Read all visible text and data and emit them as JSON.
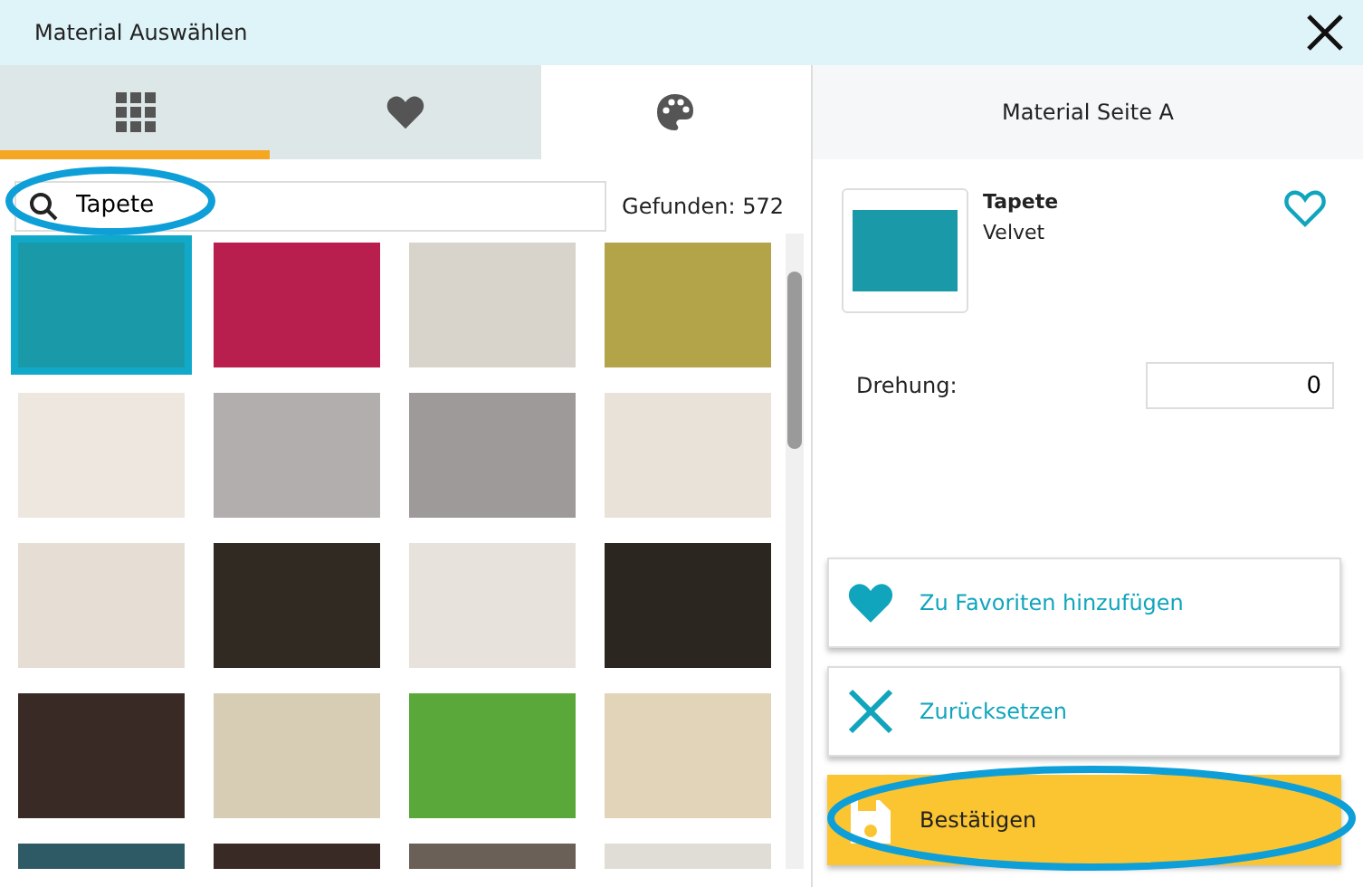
{
  "window": {
    "title": "Material Auswählen"
  },
  "tabs": [
    {
      "kind": "grid",
      "selected": false,
      "highlighted": true
    },
    {
      "kind": "heart",
      "selected": false,
      "highlighted": false
    },
    {
      "kind": "palette",
      "selected": true,
      "highlighted": false
    }
  ],
  "search": {
    "value": "Tapete",
    "result_count": "Gefunden: 572"
  },
  "swatches": [
    {
      "color": "#1a9aa8",
      "selected": true
    },
    {
      "color": "#b81e4e",
      "selected": false
    },
    {
      "color": "#d8d4cc",
      "selected": false
    },
    {
      "color": "#b3a44a",
      "selected": false
    },
    {
      "color": "#ede7e0",
      "selected": false
    },
    {
      "color": "#b3aeae",
      "selected": false
    },
    {
      "color": "#9e9a9a",
      "selected": false
    },
    {
      "color": "#e9e2d8",
      "selected": false
    },
    {
      "color": "#e6ded4",
      "selected": false
    },
    {
      "color": "#312a22",
      "selected": false
    },
    {
      "color": "#e8e2dd",
      "selected": false
    },
    {
      "color": "#2c2620",
      "selected": false
    },
    {
      "color": "#3a2a26",
      "selected": false
    },
    {
      "color": "#d7cdb5",
      "selected": false
    },
    {
      "color": "#5aa83a",
      "selected": false
    },
    {
      "color": "#e1d4b8",
      "selected": false
    },
    {
      "color": "#2e5a66",
      "selected": false
    },
    {
      "color": "#3a2a26",
      "selected": false
    },
    {
      "color": "#6a6058",
      "selected": false
    },
    {
      "color": "#e0dcd6",
      "selected": false
    }
  ],
  "side_panel": {
    "title": "Material Seite A",
    "material": {
      "name": "Tapete",
      "variant": "Velvet",
      "color": "#1a9aa8",
      "favorite": false
    },
    "rotation": {
      "label": "Drehung:",
      "value": "0"
    },
    "buttons": [
      {
        "kind": "favorite",
        "label": "Zu Favoriten hinzufügen"
      },
      {
        "kind": "reset",
        "label": "Zurücksetzen"
      },
      {
        "kind": "confirm",
        "label": "Bestätigen"
      }
    ]
  }
}
